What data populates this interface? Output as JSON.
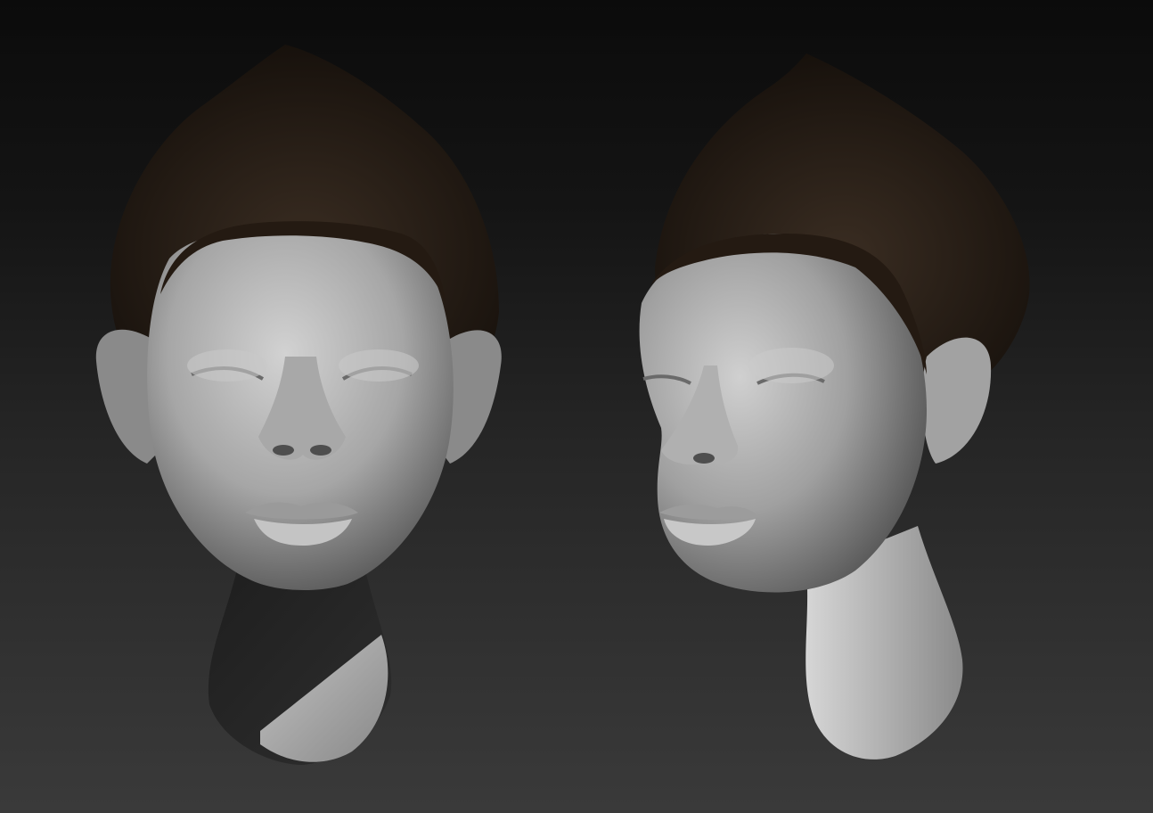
{
  "scene": {
    "background": {
      "top_color": "#0b0b0b",
      "bottom_color": "#3a3a3a"
    },
    "models": [
      {
        "name": "head-front-view",
        "view": "front",
        "hair_color": "#2a1f17",
        "skin_color": "#b4b4b4"
      },
      {
        "name": "head-three-quarter-view",
        "view": "three-quarter",
        "hair_color": "#2a1f17",
        "skin_color": "#b4b4b4"
      }
    ]
  }
}
